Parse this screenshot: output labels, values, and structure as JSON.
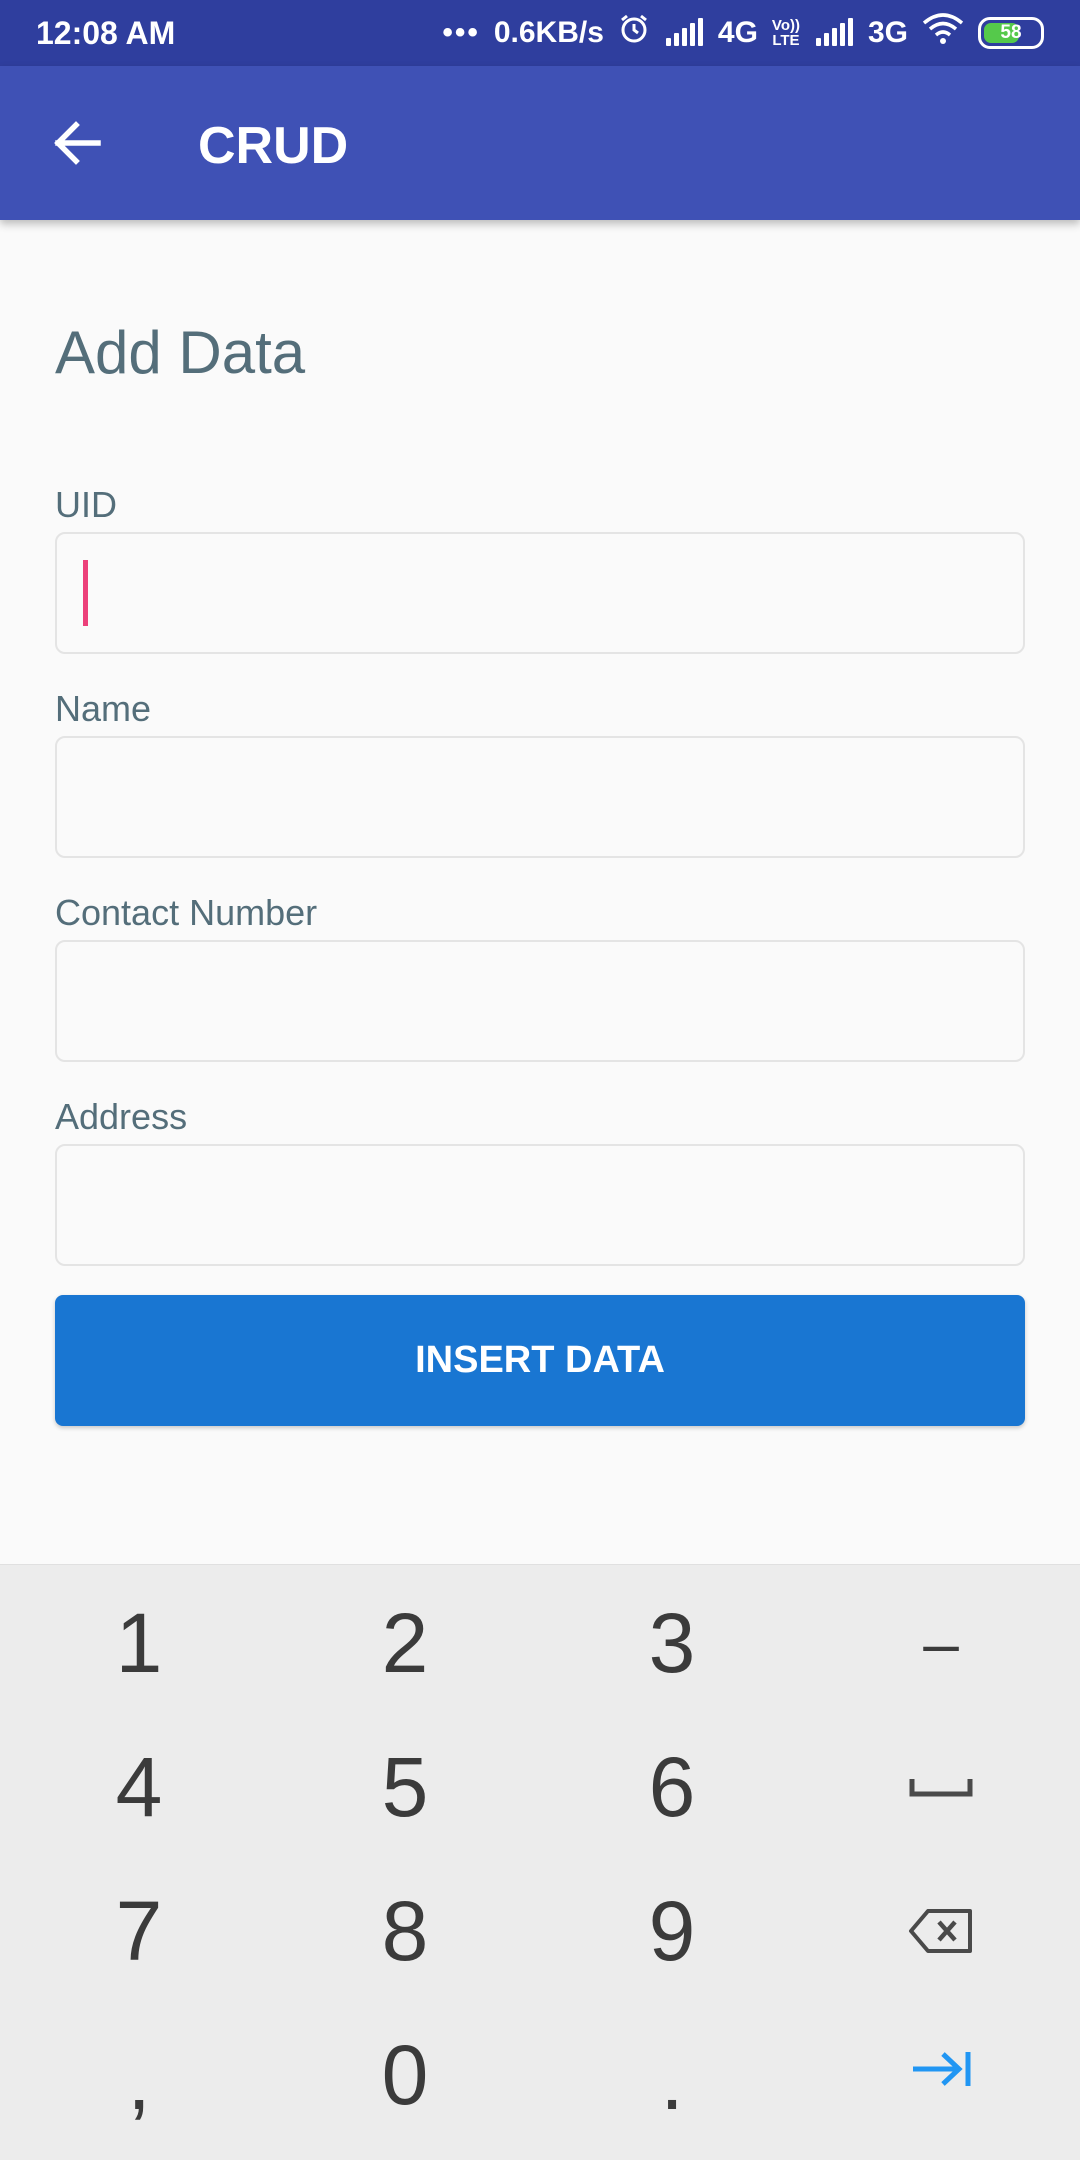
{
  "status_bar": {
    "time": "12:08 AM",
    "dots": "•••",
    "net_speed": "0.6KB/s",
    "net1": "4G",
    "volte_top": "Vo))",
    "volte_bottom": "LTE",
    "net2": "3G",
    "battery": "58",
    "colors": {
      "battery_fill": "#55c94b",
      "bg": "#2f3e9e"
    }
  },
  "app_bar": {
    "title": "CRUD",
    "back_icon": "arrow-back-icon",
    "bg": "#3f51b5"
  },
  "form": {
    "title": "Add Data",
    "fields": [
      {
        "label": "UID",
        "value": "",
        "focused": true
      },
      {
        "label": "Name",
        "value": ""
      },
      {
        "label": "Contact Number",
        "value": ""
      },
      {
        "label": "Address",
        "value": ""
      }
    ],
    "submit_label": "INSERT DATA",
    "colors": {
      "accent": "#1976d2",
      "caret": "#ec407a",
      "label": "#546e7a"
    }
  },
  "keyboard": {
    "rows": [
      [
        "1",
        "2",
        "3",
        "–"
      ],
      [
        "4",
        "5",
        "6",
        "space"
      ],
      [
        "7",
        "8",
        "9",
        "backspace"
      ],
      [
        ",",
        "0",
        ".",
        "next"
      ]
    ],
    "keys": {
      "k1": "1",
      "k2": "2",
      "k3": "3",
      "dash": "–",
      "k4": "4",
      "k5": "5",
      "k6": "6",
      "k7": "7",
      "k8": "8",
      "k9": "9",
      "comma": ",",
      "k0": "0",
      "period": "."
    },
    "icons": {
      "space": "space-bar-icon",
      "backspace": "backspace-icon",
      "next": "next-tab-icon"
    },
    "colors": {
      "bg": "#ececec",
      "next_icon": "#2196f3"
    }
  }
}
